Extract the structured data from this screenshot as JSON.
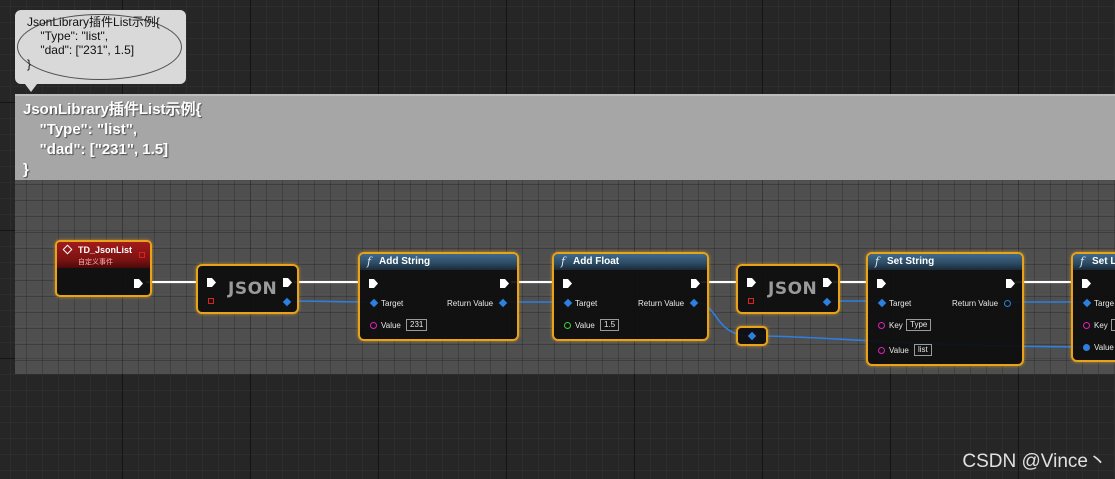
{
  "comment_bubble": {
    "lines": [
      "JsonLibrary插件List示例{",
      "    \"Type\": \"list\",",
      "    \"dad\": [\"231\", 1.5]",
      "}"
    ]
  },
  "comment_box": {
    "lines": [
      "JsonLibrary插件List示例{",
      "    \"Type\": \"list\",",
      "    \"dad\": [\"231\", 1.5]",
      "}"
    ]
  },
  "nodes": {
    "event": {
      "title": "TD_JsonList",
      "subtitle": "自定义事件"
    },
    "json1": {
      "label": "JSON"
    },
    "add_string": {
      "fn_icon": "f",
      "title": "Add String",
      "target_label": "Target",
      "return_label": "Return Value",
      "value_label": "Value",
      "value": "231"
    },
    "add_float": {
      "fn_icon": "f",
      "title": "Add Float",
      "target_label": "Target",
      "return_label": "Return Value",
      "value_label": "Value",
      "value": "1.5"
    },
    "json2": {
      "label": "JSON"
    },
    "set_string": {
      "fn_icon": "f",
      "title": "Set String",
      "target_label": "Target",
      "return_label": "Return Value",
      "key_label": "Key",
      "key": "Type",
      "value_label": "Value",
      "value": "list"
    },
    "set_list": {
      "fn_icon": "f",
      "title": "Set L",
      "target_label": "Targe",
      "key_label": "Key",
      "value_label": "Value"
    }
  },
  "watermark": "CSDN @Vince丶",
  "colors": {
    "node_border": "#e8a318",
    "exec_wire": "#ffffff",
    "object_wire": "#2d7fe0",
    "string_pin": "#e020c0",
    "float_pin": "#3ad13a",
    "event_header": "#a21c1c",
    "function_header": "#3f6a8c"
  }
}
